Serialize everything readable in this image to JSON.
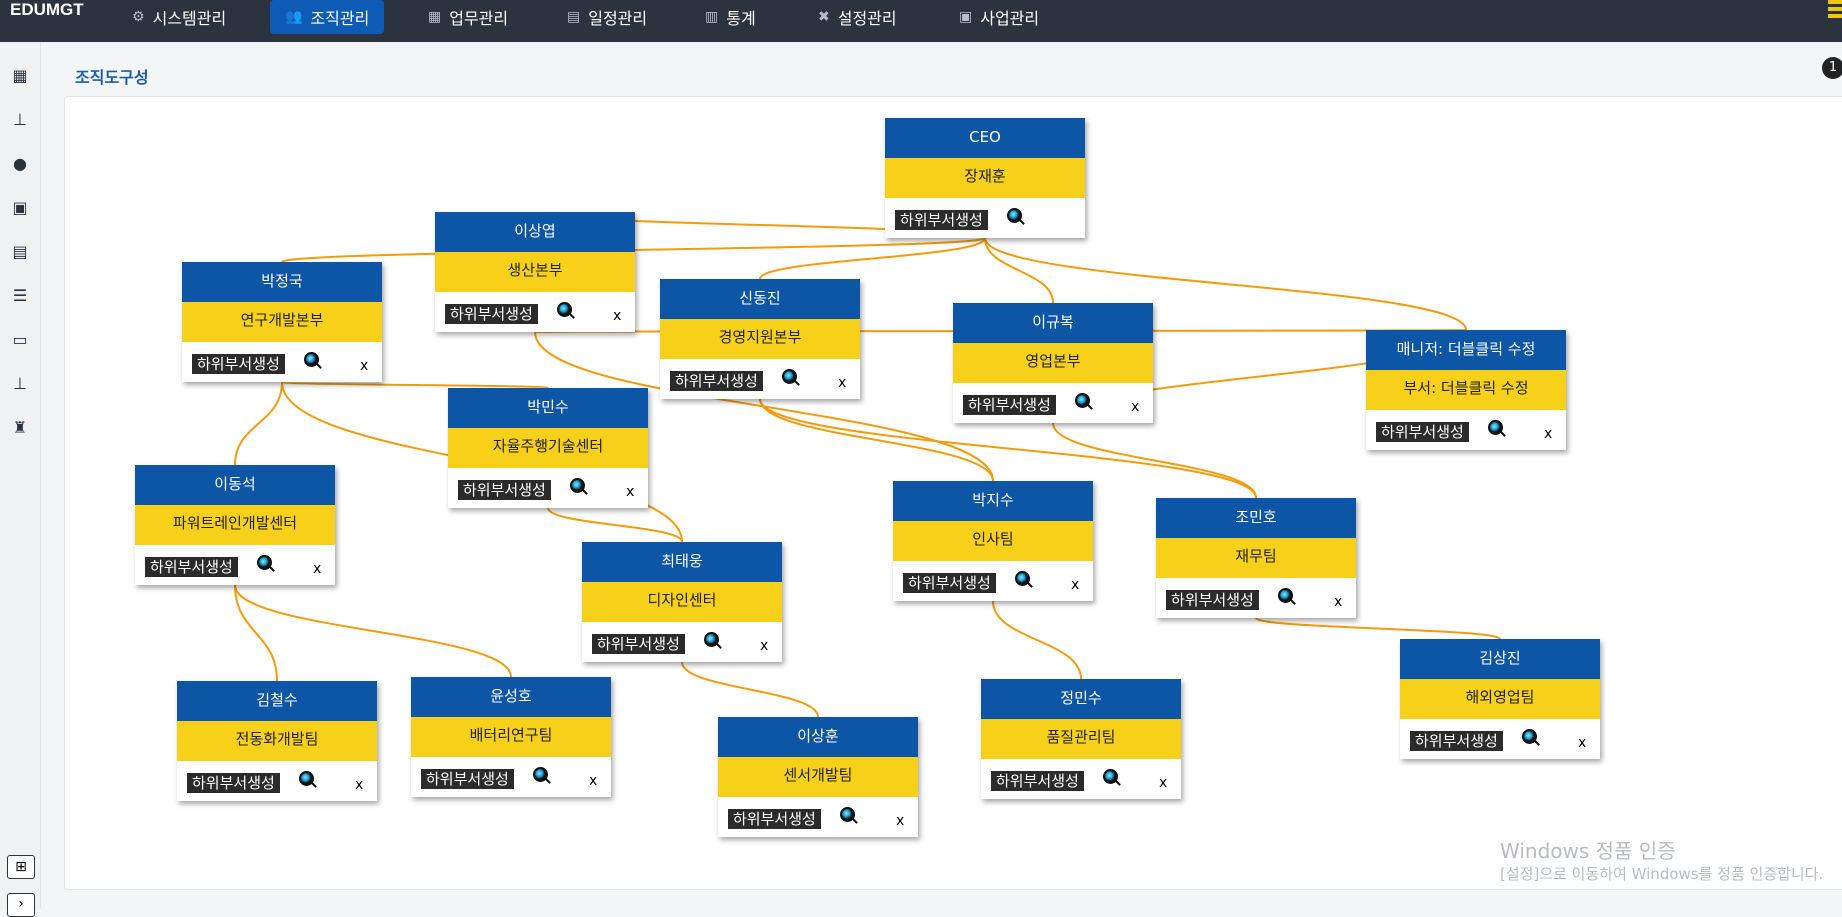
{
  "brand": "EDUMGT",
  "nav": [
    {
      "label": "시스템관리",
      "icon": "gears-icon",
      "glyph": "⚙"
    },
    {
      "label": "조직관리",
      "icon": "users-icon",
      "glyph": "👥"
    },
    {
      "label": "업무관리",
      "icon": "building-icon",
      "glyph": "▦"
    },
    {
      "label": "일정관리",
      "icon": "calendar-icon",
      "glyph": "▤"
    },
    {
      "label": "통계",
      "icon": "chart-icon",
      "glyph": "▥"
    },
    {
      "label": "설정관리",
      "icon": "tools-icon",
      "glyph": "✖"
    },
    {
      "label": "사업관리",
      "icon": "briefcase-icon",
      "glyph": "▣"
    }
  ],
  "sidebar_icons": [
    {
      "name": "calendar-icon",
      "glyph": "▦"
    },
    {
      "name": "org-chart-icon",
      "glyph": "⊥"
    },
    {
      "name": "user-icon",
      "glyph": "●"
    },
    {
      "name": "calendar-plus-icon",
      "glyph": "▣"
    },
    {
      "name": "clipboard-icon",
      "glyph": "▤"
    },
    {
      "name": "server-icon",
      "glyph": "☰"
    },
    {
      "name": "ticket-icon",
      "glyph": "▭"
    },
    {
      "name": "sitemap-icon",
      "glyph": "⊥"
    },
    {
      "name": "shirt-icon",
      "glyph": "♜"
    }
  ],
  "sidebar_toggle": "⊞",
  "sidebar_next": "›",
  "page_title": "조직도구성",
  "help_badge": "1",
  "node_labels": {
    "add": "하위부서생성",
    "delete": "x"
  },
  "nodes": [
    {
      "id": "ceo",
      "manager": "CEO",
      "dept": "장재훈",
      "delete": false
    },
    {
      "id": "prod",
      "manager": "이상엽",
      "dept": "생산본부",
      "delete": true
    },
    {
      "id": "rnd",
      "manager": "박정국",
      "dept": "연구개발본부",
      "delete": true
    },
    {
      "id": "mgmt",
      "manager": "신동진",
      "dept": "경영지원본부",
      "delete": true
    },
    {
      "id": "sales",
      "manager": "이규복",
      "dept": "영업본부",
      "delete": true
    },
    {
      "id": "new",
      "manager": "매니저: 더블클릭 수정",
      "dept": "부서: 더블클릭 수정",
      "delete": true
    },
    {
      "id": "auto",
      "manager": "박민수",
      "dept": "자율주행기술센터",
      "delete": true
    },
    {
      "id": "power",
      "manager": "이동석",
      "dept": "파워트레인개발센터",
      "delete": true
    },
    {
      "id": "design",
      "manager": "최태웅",
      "dept": "디자인센터",
      "delete": true
    },
    {
      "id": "hr",
      "manager": "박지수",
      "dept": "인사팀",
      "delete": true
    },
    {
      "id": "fin",
      "manager": "조민호",
      "dept": "재무팀",
      "delete": true
    },
    {
      "id": "elec",
      "manager": "김철수",
      "dept": "전동화개발팀",
      "delete": true
    },
    {
      "id": "batt",
      "manager": "윤성호",
      "dept": "배터리연구팀",
      "delete": true
    },
    {
      "id": "sensor",
      "manager": "이상훈",
      "dept": "센서개발팀",
      "delete": true
    },
    {
      "id": "qa",
      "manager": "정민수",
      "dept": "품질관리팀",
      "delete": true
    },
    {
      "id": "intl",
      "manager": "김상진",
      "dept": "해외영업팀",
      "delete": true
    }
  ],
  "edges": [
    [
      "ceo",
      "prod"
    ],
    [
      "ceo",
      "rnd"
    ],
    [
      "ceo",
      "mgmt"
    ],
    [
      "ceo",
      "sales"
    ],
    [
      "ceo",
      "new"
    ],
    [
      "rnd",
      "auto"
    ],
    [
      "rnd",
      "power"
    ],
    [
      "rnd",
      "design"
    ],
    [
      "prod",
      "hr"
    ],
    [
      "prod",
      "new"
    ],
    [
      "mgmt",
      "hr"
    ],
    [
      "mgmt",
      "fin"
    ],
    [
      "sales",
      "fin"
    ],
    [
      "sales",
      "new"
    ],
    [
      "auto",
      "design"
    ],
    [
      "power",
      "elec"
    ],
    [
      "power",
      "batt"
    ],
    [
      "design",
      "sensor"
    ],
    [
      "hr",
      "qa"
    ],
    [
      "fin",
      "intl"
    ]
  ],
  "line_color": "#f59b0b",
  "watermark": {
    "line1": "Windows 정품 인증",
    "line2": "[설정]으로 이동하여 Windows를 정품 인증합니다."
  }
}
